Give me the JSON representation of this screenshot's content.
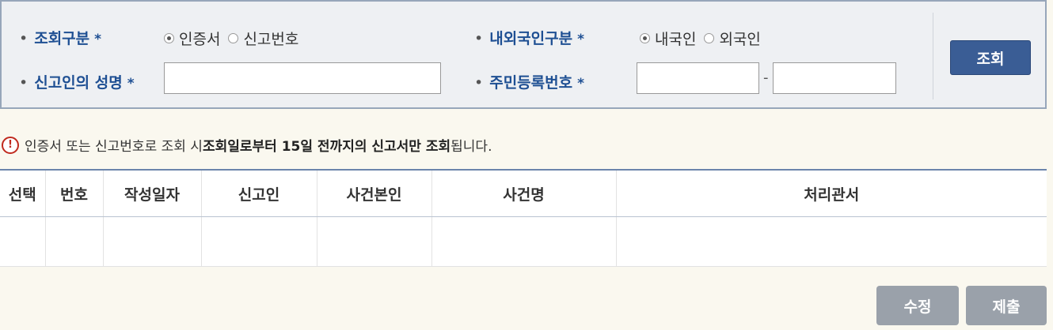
{
  "search": {
    "query_type_label": "조회구분",
    "query_type_options": [
      "인증서",
      "신고번호"
    ],
    "query_type_selected": 0,
    "nationality_label": "내외국인구분",
    "nationality_options": [
      "내국인",
      "외국인"
    ],
    "nationality_selected": 0,
    "reporter_name_label": "신고인의 성명",
    "reporter_name_value": "",
    "resident_no_label": "주민등록번호",
    "resident_no_front": "",
    "resident_no_back": "",
    "resident_no_separator": "-",
    "required_mark": "*",
    "bullet": "•",
    "search_button": "조회"
  },
  "notice": {
    "icon": "!",
    "text_prefix": "인증서 또는 신고번호로 조회 시 ",
    "text_bold": "조회일로부터 15일 전까지의 신고서만 조회",
    "text_suffix": "됩니다."
  },
  "table": {
    "columns": [
      "선택",
      "번호",
      "작성일자",
      "신고인",
      "사건본인",
      "사건명",
      "처리관서"
    ],
    "rows": [
      [
        "",
        "",
        "",
        "",
        "",
        "",
        ""
      ]
    ]
  },
  "actions": {
    "edit_label": "수정",
    "submit_label": "제출"
  },
  "colors": {
    "accent": "#1e4f93",
    "search_button": "#3a5d95",
    "disabled_button": "#9aa1aa",
    "notice_icon": "#c02a1e"
  }
}
